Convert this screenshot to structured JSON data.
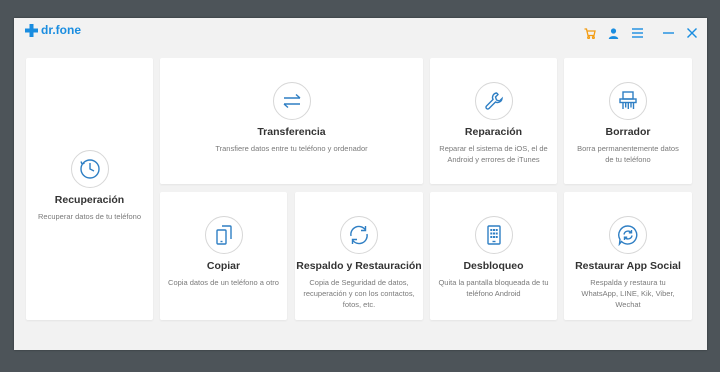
{
  "app": {
    "name": "dr.fone"
  },
  "titlebar": {
    "cart_icon": "cart-icon",
    "user_icon": "user-icon",
    "menu_icon": "menu-icon",
    "minimize_icon": "minimize-icon",
    "close_icon": "close-icon"
  },
  "colors": {
    "accent": "#1a8de0",
    "cart": "#f39c12",
    "icon": "#2f7fc4"
  },
  "modules": {
    "recuperacion": {
      "title": "Recuperación",
      "desc": "Recuperar datos de tu teléfono",
      "icon": "clock-icon"
    },
    "transferencia": {
      "title": "Transferencia",
      "desc": "Transfiere datos entre tu teléfono y ordenador",
      "icon": "transfer-arrows-icon"
    },
    "reparacion": {
      "title": "Reparación",
      "desc": "Reparar el sistema de iOS, el de Android y errores de iTunes",
      "icon": "wrench-icon"
    },
    "borrador": {
      "title": "Borrador",
      "desc": "Borra permanentemente datos de tu teléfono",
      "icon": "shredder-icon"
    },
    "copiar": {
      "title": "Copiar",
      "desc": "Copia datos de un teléfono a otro",
      "icon": "phone-copy-icon"
    },
    "respaldo": {
      "title": "Respaldo y Restauración",
      "desc": "Copia de Seguridad de datos, recuperación y con los contactos, fotos, etc.",
      "icon": "sync-icon"
    },
    "desbloqueo": {
      "title": "Desbloqueo",
      "desc": "Quita la pantalla bloqueada de tu teléfono Android",
      "icon": "phone-keypad-icon"
    },
    "restaurar_social": {
      "title": "Restaurar App Social",
      "desc": "Respalda y restaura tu WhatsApp, LINE, Kik, Viber, Wechat",
      "icon": "chat-restore-icon"
    }
  }
}
